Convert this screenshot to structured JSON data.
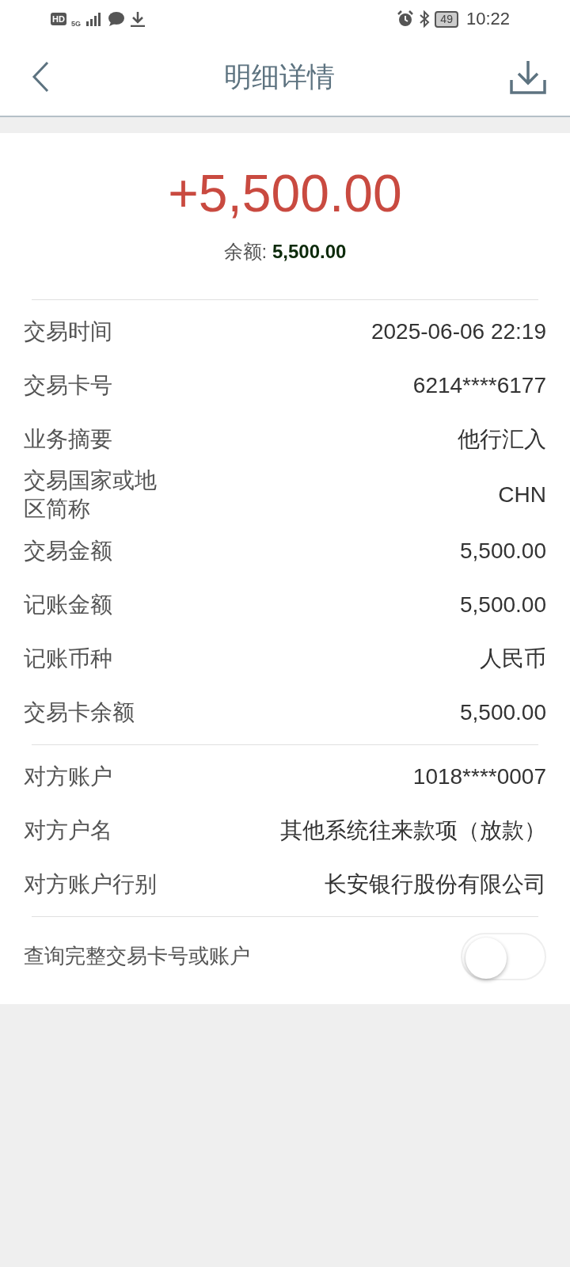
{
  "status_bar": {
    "hd": "HD",
    "network": "5G",
    "battery": "49",
    "time": "10:22"
  },
  "header": {
    "title": "明细详情"
  },
  "amount": "+5,500.00",
  "balance": {
    "label": "余额:",
    "value": "5,500.00"
  },
  "sections": [
    {
      "rows": [
        {
          "label": "交易时间",
          "value": "2025-06-06 22:19"
        },
        {
          "label": "交易卡号",
          "value": "6214****6177"
        },
        {
          "label": "业务摘要",
          "value": "他行汇入"
        },
        {
          "label": "交易国家或地区简称",
          "value": "CHN"
        },
        {
          "label": "交易金额",
          "value": "5,500.00"
        },
        {
          "label": "记账金额",
          "value": "5,500.00"
        },
        {
          "label": "记账币种",
          "value": "人民币"
        },
        {
          "label": "交易卡余额",
          "value": "5,500.00"
        }
      ]
    },
    {
      "rows": [
        {
          "label": "对方账户",
          "value": "1018****0007"
        },
        {
          "label": "对方户名",
          "value": "其他系统往来款项（放款）"
        },
        {
          "label": "对方账户行别",
          "value": "长安银行股份有限公司"
        }
      ]
    }
  ],
  "toggle": {
    "label": "查询完整交易卡号或账户",
    "on": false
  }
}
